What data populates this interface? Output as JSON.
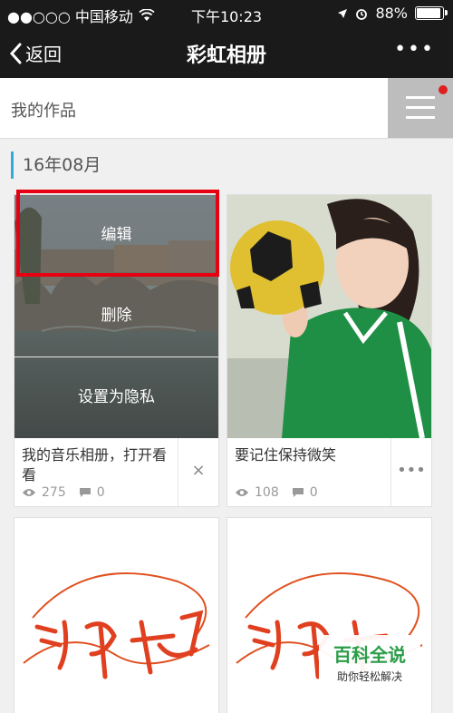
{
  "status_bar": {
    "carrier": "●●○○○ 中国移动",
    "time": "下午10:23",
    "battery": "88%",
    "battery_level": 0.88
  },
  "nav": {
    "back_label": "返回",
    "title": "彩虹相册",
    "more_label": "•••"
  },
  "section": {
    "title": "我的作品"
  },
  "month_label": "16年08月",
  "cards": [
    {
      "caption": "我的音乐相册，打开看看",
      "views": "275",
      "comments": "0",
      "action_icon": "×",
      "menu": [
        "编辑",
        "删除",
        "设置为隐私"
      ]
    },
    {
      "caption": "要记住保持微笑",
      "views": "108",
      "comments": "0",
      "action_icon": "•••"
    }
  ],
  "watermark": {
    "title": "百科全说",
    "subtitle": "助你轻松解决"
  },
  "colors": {
    "bar_bg": "#1a1a1a",
    "accent_blue": "#33aadd",
    "highlight_red": "#e60012",
    "notification_red": "#e02020",
    "watermark_green": "#2a9d48"
  }
}
